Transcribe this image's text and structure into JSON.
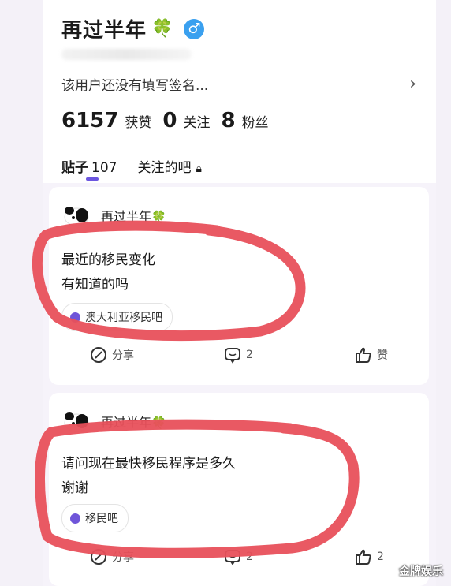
{
  "profile": {
    "name": "再过半年",
    "name_emoji": "🍀",
    "gender_icon": "♂",
    "signature": "该用户还没有填写签名...",
    "stats": [
      {
        "value": "6157",
        "label": "获赞"
      },
      {
        "value": "0",
        "label": "关注"
      },
      {
        "value": "8",
        "label": "粉丝"
      }
    ]
  },
  "tabs": {
    "posts_label": "贴子",
    "posts_count": "107",
    "followed_bars_label": "关注的吧"
  },
  "posts": [
    {
      "author": "再过半年",
      "author_emoji": "🍀",
      "line1": "最近的移民变化",
      "line2": "有知道的吗",
      "bar": "澳大利亚移民吧",
      "share_label": "分享",
      "comments": "2",
      "like_label": "赞"
    },
    {
      "author": "再过半年",
      "author_emoji": "🍀",
      "line1": "请问现在最快移民程序是多久",
      "line2": "谢谢",
      "bar": "移民吧",
      "share_label": "分享",
      "comments": "2",
      "likes": "2"
    }
  ],
  "watermark": "金牌娱乐",
  "colors": {
    "accent": "#6c56e0",
    "gender_badge": "#3aa0ef",
    "annotation": "#e8505b"
  }
}
